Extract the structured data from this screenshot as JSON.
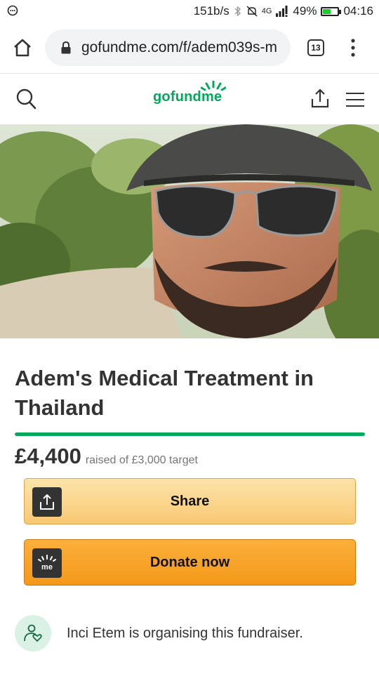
{
  "status_bar": {
    "speed": "151b/s",
    "network": "4G",
    "battery_percent": "49%",
    "battery_level": 0.49,
    "time": "04:16"
  },
  "browser": {
    "url": "gofundme.com/f/adem039s-m",
    "tab_count": "13"
  },
  "site": {
    "logo_text": "gofundme",
    "brand_color": "#02a95c"
  },
  "campaign": {
    "title": "Adem's Medical Treatment in Thailand",
    "raised": "£4,400",
    "raised_label": "raised of £3,000 target",
    "progress_fraction": 1.0
  },
  "buttons": {
    "share_label": "Share",
    "donate_label": "Donate now"
  },
  "organiser": {
    "text": "Inci Etem is organising this fundraiser."
  },
  "icons": {
    "status": [
      "message-icon",
      "bluetooth-icon",
      "mute-icon",
      "signal-icon",
      "battery-icon"
    ],
    "browser": [
      "home-icon",
      "lock-icon",
      "tab-count-icon",
      "menu-dots-icon"
    ],
    "header": [
      "search-icon",
      "share-icon",
      "hamburger-icon"
    ],
    "buttons": [
      "share-icon",
      "gofundme-me-icon"
    ],
    "organiser": [
      "organiser-heart-icon"
    ]
  }
}
